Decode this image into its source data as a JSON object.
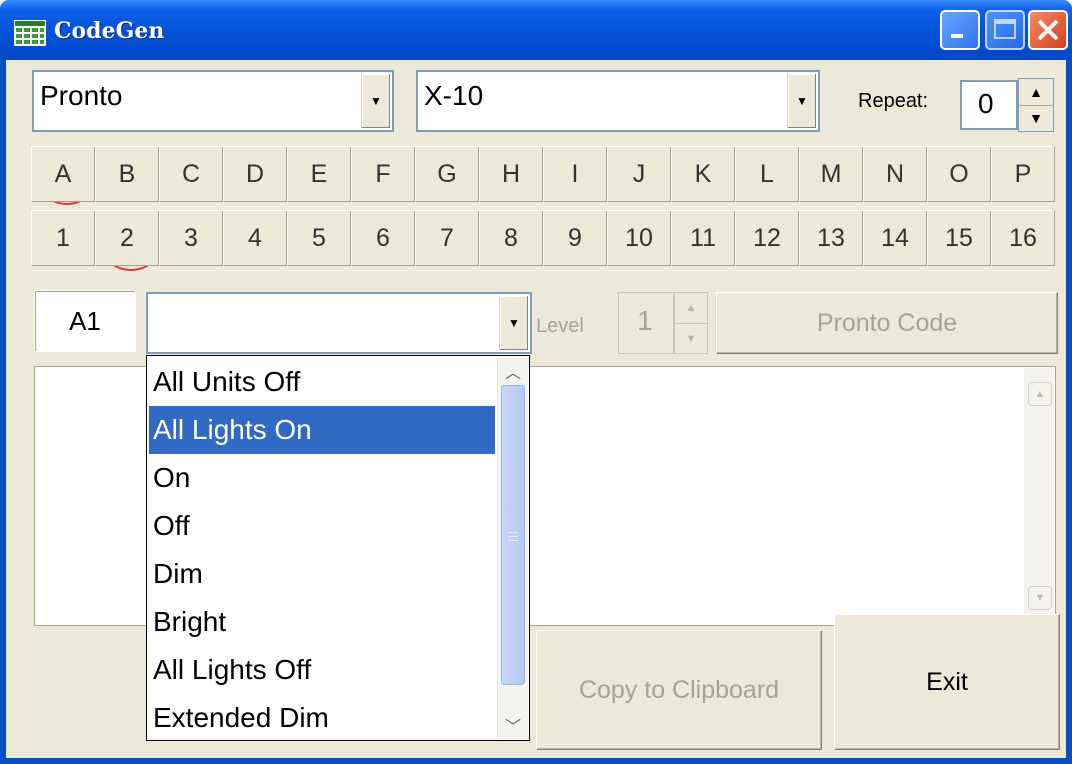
{
  "window": {
    "title": "CodeGen"
  },
  "format_combo": {
    "value": "Pronto"
  },
  "protocol_combo": {
    "value": "X-10"
  },
  "repeat": {
    "label": "Repeat:",
    "value": "0"
  },
  "house_codes": [
    "A",
    "B",
    "C",
    "D",
    "E",
    "F",
    "G",
    "H",
    "I",
    "J",
    "K",
    "L",
    "M",
    "N",
    "O",
    "P"
  ],
  "unit_codes": [
    "1",
    "2",
    "3",
    "4",
    "5",
    "6",
    "7",
    "8",
    "9",
    "10",
    "11",
    "12",
    "13",
    "14",
    "15",
    "16"
  ],
  "selected": {
    "house": "A",
    "unit": "2",
    "address": "A1"
  },
  "command_combo": {
    "value": ""
  },
  "level": {
    "label": "Level",
    "value": "1"
  },
  "pronto_code_button": "Pronto Code",
  "copy_button": "Copy to Clipboard",
  "exit_button": "Exit",
  "command_list": {
    "items": [
      "All Units Off",
      "All Lights On",
      "On",
      "Off",
      "Dim",
      "Bright",
      "All Lights Off",
      "Extended Dim"
    ],
    "selected_index": 1
  },
  "colors": {
    "selection": "#316ac5",
    "titlebar": "#0552d8",
    "face": "#ece9d8",
    "highlight_circle": "#e03a3a"
  }
}
